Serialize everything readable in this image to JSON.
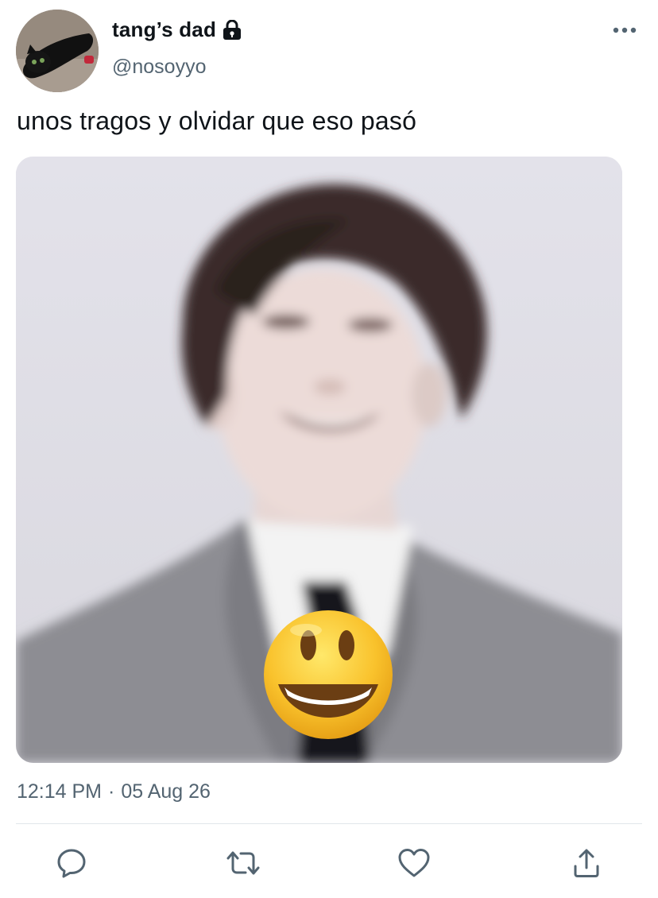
{
  "author": {
    "display_name": "tang’s dad",
    "handle": "@nosoyyo",
    "protected": true,
    "avatar_icon": "black-cat-avatar"
  },
  "tweet": {
    "text": "unos tragos y olvidar que eso pasó",
    "media_icon": "blurred-portrait-with-grinning-emoji",
    "time": "12:14 PM",
    "separator": "·",
    "date": "05 Aug 26"
  },
  "actions": [
    {
      "name": "reply",
      "icon": "speech-bubble-icon"
    },
    {
      "name": "retweet",
      "icon": "retweet-arrows-icon"
    },
    {
      "name": "like",
      "icon": "heart-icon"
    },
    {
      "name": "share",
      "icon": "share-upload-icon"
    }
  ],
  "colors": {
    "text_primary": "#0f1419",
    "text_secondary": "#536471",
    "icon": "#536471",
    "divider": "#e1e6ea"
  }
}
